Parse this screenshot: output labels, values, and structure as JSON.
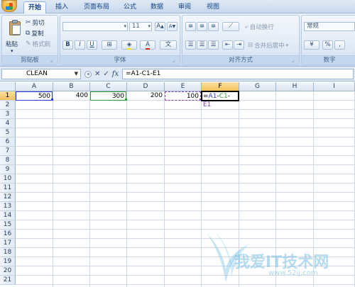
{
  "ribbon": {
    "tabs": [
      {
        "label": "开始",
        "active": true
      },
      {
        "label": "插入",
        "active": false
      },
      {
        "label": "页面布局",
        "active": false
      },
      {
        "label": "公式",
        "active": false
      },
      {
        "label": "数据",
        "active": false
      },
      {
        "label": "审阅",
        "active": false
      },
      {
        "label": "视图",
        "active": false
      }
    ],
    "clipboard": {
      "paste": "粘贴",
      "cut": "剪切",
      "copy": "复制",
      "format_painter": "格式刷",
      "label": "剪贴板"
    },
    "font": {
      "font_name": "",
      "font_size": "11",
      "grow": "A",
      "shrink": "A",
      "bold": "B",
      "italic": "I",
      "underline": "U",
      "font_color": "A",
      "label": "字体"
    },
    "alignment": {
      "wrap_text": "自动换行",
      "merge_center": "合并后居中",
      "label": "对齐方式"
    },
    "number": {
      "format": "常规",
      "percent": "%",
      "comma": ",",
      "label": "数字"
    }
  },
  "formula_bar": {
    "name_box": "CLEAN",
    "cancel": "✕",
    "enter": "✓",
    "fx": "fx",
    "formula": "=A1-C1-E1"
  },
  "sheet": {
    "columns": [
      "A",
      "B",
      "C",
      "D",
      "E",
      "F",
      "G",
      "H",
      "I"
    ],
    "rows": [
      "1",
      "2",
      "3",
      "4",
      "5",
      "6",
      "7",
      "8",
      "9",
      "10",
      "11",
      "12",
      "13",
      "14",
      "15",
      "16",
      "17",
      "18",
      "19",
      "20",
      "21"
    ],
    "selected_column": "F",
    "selected_row": "1",
    "cells": {
      "A1": "500",
      "B1": "400",
      "C1": "300",
      "D1": "200",
      "E1": "100"
    },
    "active_cell_formula": {
      "eq": "=",
      "ref1": "A1",
      "op1": "-",
      "ref2": "C1",
      "op2": "-",
      "ref3": "E1"
    },
    "ref_colors": {
      "A1": "#2f3bd6",
      "C1": "#2e9a3a",
      "E1": "#8a3fb0"
    }
  },
  "watermark": {
    "text": "我爱IT技术网",
    "url": "www.52ij.com"
  }
}
